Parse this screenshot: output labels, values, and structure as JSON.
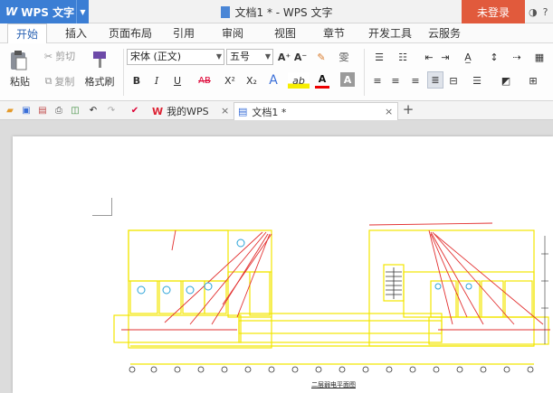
{
  "app": {
    "name": "WPS 文字",
    "logo": "W"
  },
  "window": {
    "title": "文档1 * - WPS 文字",
    "login": "未登录"
  },
  "menu": {
    "tabs": [
      "开始",
      "插入",
      "页面布局",
      "引用",
      "审阅",
      "视图",
      "章节",
      "开发工具",
      "云服务"
    ],
    "active": 0
  },
  "ribbon": {
    "paste": "粘贴",
    "cut": "剪切",
    "copy": "复制",
    "format_painter": "格式刷",
    "font_name": "宋体 (正文)",
    "font_size": "五号",
    "bold": "B",
    "italic": "I",
    "underline": "U",
    "strike": "AB",
    "superscript": "X²",
    "subscript": "X₂",
    "text_effect": "A",
    "highlight": "ab",
    "font_color": "A",
    "char_shade": "A",
    "grow": "A⁺",
    "shrink": "A⁻",
    "clear": "✎",
    "pinyin": "雯"
  },
  "quickbar": {
    "tabs": [
      {
        "label": "我的WPS",
        "icon": "W"
      },
      {
        "label": "文档1 *",
        "icon": "▤"
      }
    ],
    "new_tab": "+",
    "close": "×"
  },
  "colors": {
    "app_blue": "#3b7ed4",
    "login_red": "#e15a3c",
    "tab_active_text": "#2a62b3",
    "cad_yellow": "#f2e600",
    "cad_red": "#e23030"
  },
  "drawing": {
    "title": "二层弱电平面图"
  }
}
